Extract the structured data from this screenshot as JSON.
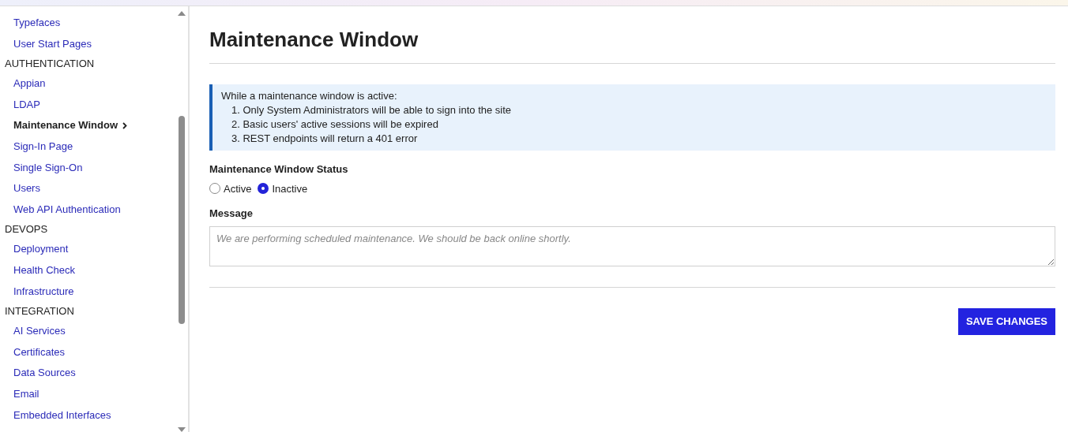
{
  "sidebar": {
    "groups": [
      {
        "items": [
          {
            "label": "Typefaces",
            "selected": false
          },
          {
            "label": "User Start Pages",
            "selected": false
          }
        ]
      },
      {
        "heading": "AUTHENTICATION",
        "items": [
          {
            "label": "Appian",
            "selected": false
          },
          {
            "label": "LDAP",
            "selected": false
          },
          {
            "label": "Maintenance Window",
            "selected": true
          },
          {
            "label": "Sign-In Page",
            "selected": false
          },
          {
            "label": "Single Sign-On",
            "selected": false
          },
          {
            "label": "Users",
            "selected": false
          },
          {
            "label": "Web API Authentication",
            "selected": false
          }
        ]
      },
      {
        "heading": "DEVOPS",
        "items": [
          {
            "label": "Deployment",
            "selected": false
          },
          {
            "label": "Health Check",
            "selected": false
          },
          {
            "label": "Infrastructure",
            "selected": false
          }
        ]
      },
      {
        "heading": "INTEGRATION",
        "items": [
          {
            "label": "AI Services",
            "selected": false
          },
          {
            "label": "Certificates",
            "selected": false
          },
          {
            "label": "Data Sources",
            "selected": false
          },
          {
            "label": "Email",
            "selected": false
          },
          {
            "label": "Embedded Interfaces",
            "selected": false
          }
        ]
      }
    ]
  },
  "page": {
    "title": "Maintenance Window",
    "info": {
      "intro": "While a maintenance window is active:",
      "items": [
        "1. Only System Administrators will be able to sign into the site",
        "2. Basic users' active sessions will be expired",
        "3. REST endpoints will return a 401 error"
      ]
    },
    "status": {
      "label": "Maintenance Window Status",
      "options": [
        {
          "label": "Active",
          "selected": false
        },
        {
          "label": "Inactive",
          "selected": true
        }
      ]
    },
    "message": {
      "label": "Message",
      "placeholder": "We are performing scheduled maintenance. We should be back online shortly."
    },
    "save_button": "SAVE CHANGES"
  }
}
